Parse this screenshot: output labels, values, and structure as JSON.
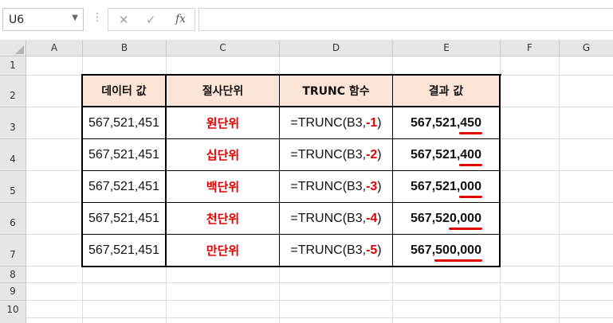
{
  "name_box": {
    "value": "U6"
  },
  "formula_bar": {
    "cancel_glyph": "✕",
    "enter_glyph": "✓",
    "fx_label": "fx",
    "content": ""
  },
  "columns": [
    "A",
    "B",
    "C",
    "D",
    "E",
    "F",
    "G"
  ],
  "rows": [
    "1",
    "2",
    "3",
    "4",
    "5",
    "6",
    "7",
    "8",
    "9",
    "10"
  ],
  "table": {
    "headers": [
      "데이터 값",
      "절사단위",
      "TRUNC 함수",
      "결과 값"
    ],
    "rows": [
      {
        "value": "567,521,451",
        "unit": "원단위",
        "formula_prefix": "=TRUNC(B3,",
        "formula_arg": "-1",
        "formula_suffix": ")",
        "result_keep": "567,521,",
        "result_hl": "450"
      },
      {
        "value": "567,521,451",
        "unit": "십단위",
        "formula_prefix": "=TRUNC(B3,",
        "formula_arg": "-2",
        "formula_suffix": ")",
        "result_keep": "567,521,",
        "result_hl": "400"
      },
      {
        "value": "567,521,451",
        "unit": "백단위",
        "formula_prefix": "=TRUNC(B3,",
        "formula_arg": "-3",
        "formula_suffix": ")",
        "result_keep": "567,521,",
        "result_hl": "000"
      },
      {
        "value": "567,521,451",
        "unit": "천단위",
        "formula_prefix": "=TRUNC(B3,",
        "formula_arg": "-4",
        "formula_suffix": ")",
        "result_keep": "567,52",
        "result_hl": "0,000"
      },
      {
        "value": "567,521,451",
        "unit": "만단위",
        "formula_prefix": "=TRUNC(B3,",
        "formula_arg": "-5",
        "formula_suffix": ")",
        "result_keep": "567,",
        "result_hl": "500,000"
      }
    ]
  },
  "colors": {
    "header_fill": "#fce4d6",
    "accent_red": "#e00000"
  }
}
